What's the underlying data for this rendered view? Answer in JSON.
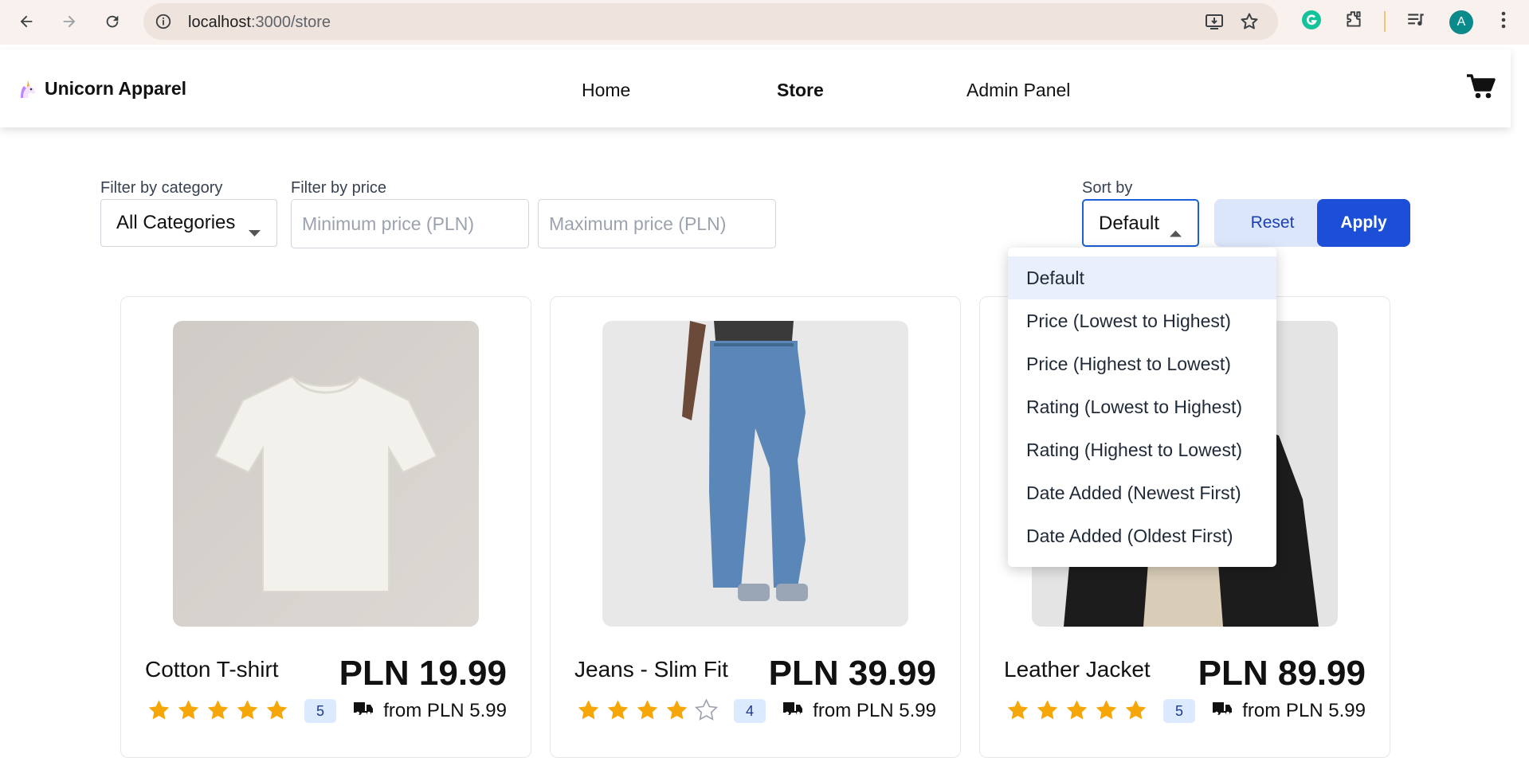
{
  "browser": {
    "url_host": "localhost",
    "url_path": ":3000/store",
    "profile_initial": "A"
  },
  "header": {
    "brand": "Unicorn Apparel",
    "nav": [
      {
        "label": "Home",
        "active": false
      },
      {
        "label": "Store",
        "active": true
      },
      {
        "label": "Admin Panel",
        "active": false
      }
    ]
  },
  "filters": {
    "category_label": "Filter by category",
    "category_value": "All Categories",
    "price_label": "Filter by price",
    "min_placeholder": "Minimum price (PLN)",
    "max_placeholder": "Maximum price (PLN)",
    "sort_label": "Sort by",
    "sort_value": "Default",
    "reset_label": "Reset",
    "apply_label": "Apply"
  },
  "sort_options": [
    "Default",
    "Price (Lowest to Highest)",
    "Price (Highest to Lowest)",
    "Rating (Lowest to Highest)",
    "Rating (Highest to Lowest)",
    "Date Added (Newest First)",
    "Date Added (Oldest First)"
  ],
  "products": [
    {
      "name": "Cotton T-shirt",
      "price": "PLN 19.99",
      "rating": 5,
      "rating_label": "5",
      "shipping": "from PLN 5.99"
    },
    {
      "name": "Jeans - Slim Fit",
      "price": "PLN 39.99",
      "rating": 4,
      "rating_label": "4",
      "shipping": "from PLN 5.99"
    },
    {
      "name": "Leather Jacket",
      "price": "PLN 89.99",
      "rating": 5,
      "rating_label": "5",
      "shipping": "from PLN 5.99"
    }
  ],
  "colors": {
    "accent": "#1d4ed8",
    "star": "#f5a70a",
    "badge_bg": "#dbeafe"
  }
}
